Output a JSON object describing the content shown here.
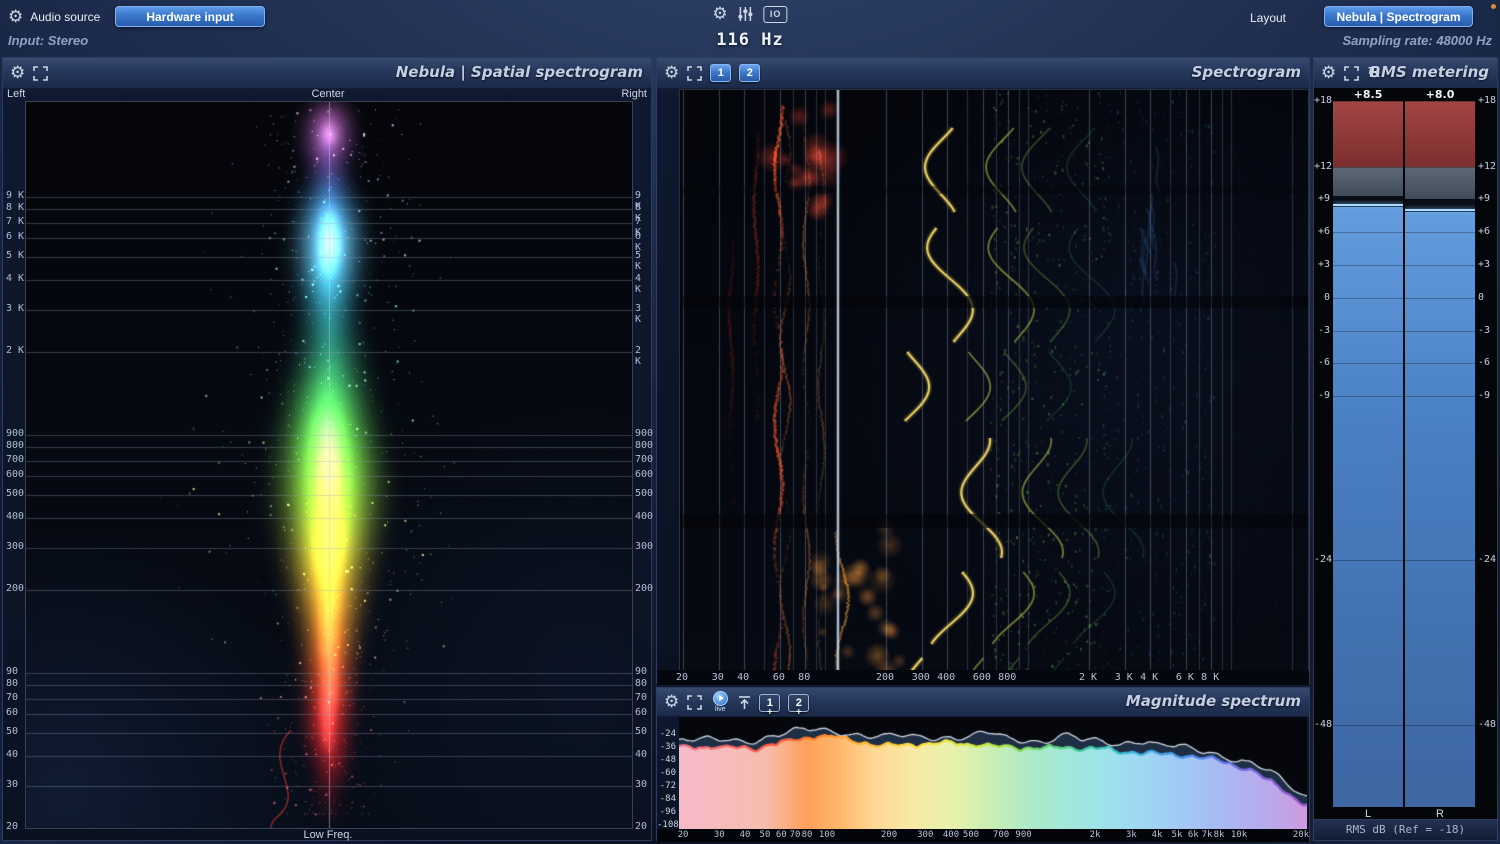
{
  "colors": {
    "accent_blue": "#3f7fd2",
    "meter_fill_blue": "#4a80c4",
    "meter_over_red": "#8f3838",
    "status_dot_orange": "#e0892a",
    "panel_title_text": "#c3cfe3"
  },
  "top_bar": {
    "audio_source_label": "Audio source",
    "hardware_input_button": "Hardware input",
    "input_status": "Input: Stereo",
    "frequency_readout": "116 Hz",
    "io_icon_label": "IO",
    "layout_button": "Layout",
    "view_preset_button": "Nebula | Spectrogram",
    "sampling_rate_status": "Sampling rate: 48000 Hz"
  },
  "spatial_panel": {
    "title": "Nebula | Spatial spectrogram",
    "top_axis": [
      "Left",
      "Center",
      "Right"
    ],
    "bottom_axis_label": "Low Freq.",
    "freq_tick_labels": [
      "9 K",
      "8 K",
      "7 K",
      "6 K",
      "5 K",
      "4 K",
      "3 K",
      "2 K",
      "900",
      "800",
      "700",
      "600",
      "500",
      "400",
      "300",
      "200",
      "90",
      "80",
      "70",
      "60",
      "50",
      "40",
      "30",
      "20"
    ],
    "freq_tick_values": [
      9000,
      8000,
      7000,
      6000,
      5000,
      4000,
      3000,
      2000,
      900,
      800,
      700,
      600,
      500,
      400,
      300,
      200,
      90,
      80,
      70,
      60,
      50,
      40,
      30,
      20
    ]
  },
  "spectrogram_panel": {
    "title": "Spectrogram",
    "layer_buttons": [
      "1",
      "2"
    ],
    "cursor_frequency_hz": 116,
    "x_tick_labels": [
      "20",
      "30",
      "40",
      "60",
      "80",
      "200",
      "300",
      "400",
      "600",
      "800",
      "2 K",
      "3 K",
      "4 K",
      "6 K",
      "8 K"
    ],
    "x_tick_values": [
      20,
      30,
      40,
      60,
      80,
      200,
      300,
      400,
      600,
      800,
      2000,
      3000,
      4000,
      6000,
      8000
    ]
  },
  "magnitude_panel": {
    "title": "Magnitude spectrum",
    "live_button_label": "live",
    "layer_buttons": [
      "1",
      "2"
    ],
    "add_symbol": "+",
    "y_tick_labels": [
      "-24",
      "-36",
      "-48",
      "-60",
      "-72",
      "-84",
      "-96",
      "-108"
    ],
    "x_tick_labels": [
      "20",
      "30",
      "40",
      "50",
      "60",
      "70",
      "80",
      "100",
      "200",
      "300",
      "400",
      "500",
      "700",
      "900",
      "2k",
      "3k",
      "4k",
      "5k",
      "6k",
      "7k",
      "8k",
      "10k",
      "20k"
    ],
    "x_tick_values": [
      20,
      30,
      40,
      50,
      60,
      70,
      80,
      100,
      200,
      300,
      400,
      500,
      700,
      900,
      2000,
      3000,
      4000,
      5000,
      6000,
      7000,
      8000,
      10000,
      20000
    ]
  },
  "rms_panel": {
    "title": "RMS metering",
    "left_value_label": "+8.5",
    "right_value_label": "+8.0",
    "left_value_db": 8.5,
    "right_value_db": 8.0,
    "scale_tick_labels": [
      "+18",
      "+12",
      "+9",
      "+6",
      "+3",
      "0",
      "-3",
      "-6",
      "-9",
      "-24",
      "-48"
    ],
    "scale_tick_values": [
      18,
      12,
      9,
      6,
      3,
      0,
      -3,
      -6,
      -9,
      -24,
      -48
    ],
    "channel_labels": [
      "L",
      "R"
    ],
    "footer_label": "RMS dB (Ref = -18)"
  }
}
